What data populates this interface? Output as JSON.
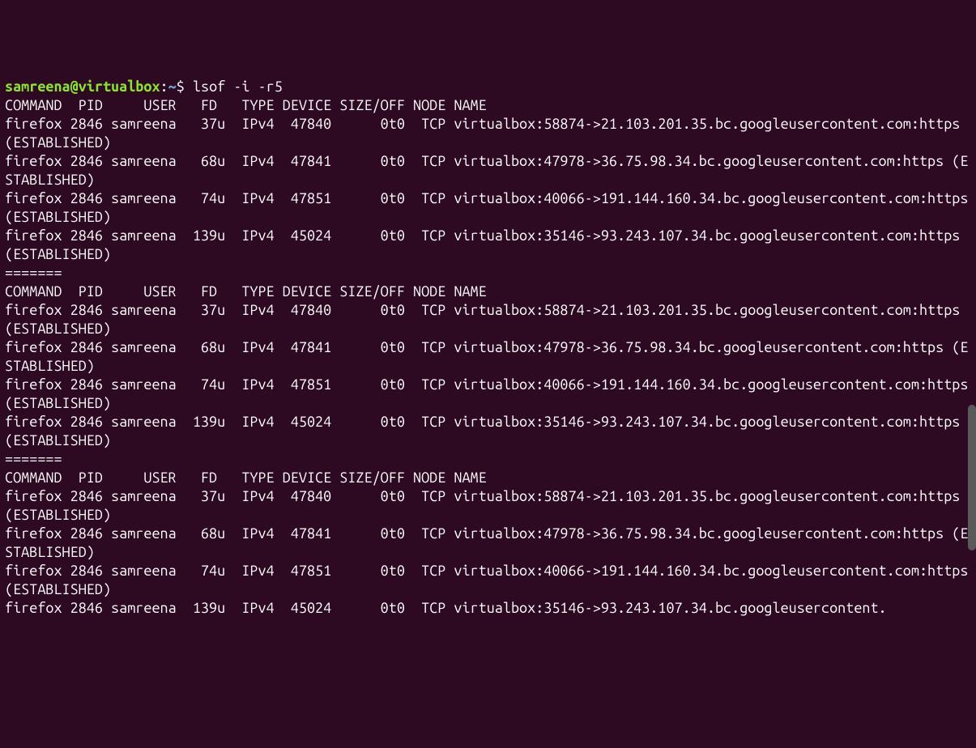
{
  "prompt": {
    "user": "samreena",
    "at": "@",
    "host": "virtualbox",
    "colon": ":",
    "path": "~",
    "dollar": "$ "
  },
  "command": "lsof -i -r5",
  "header": "COMMAND  PID     USER   FD   TYPE DEVICE SIZE/OFF NODE NAME",
  "separator": "=======",
  "blocks": [
    {
      "rows": [
        "firefox 2846 samreena   37u  IPv4  47840      0t0  TCP virtualbox:58874->21.103.201.35.bc.googleusercontent.com:https (ESTABLISHED)",
        "firefox 2846 samreena   68u  IPv4  47841      0t0  TCP virtualbox:47978->36.75.98.34.bc.googleusercontent.com:https (ESTABLISHED)",
        "firefox 2846 samreena   74u  IPv4  47851      0t0  TCP virtualbox:40066->191.144.160.34.bc.googleusercontent.com:https (ESTABLISHED)",
        "firefox 2846 samreena  139u  IPv4  45024      0t0  TCP virtualbox:35146->93.243.107.34.bc.googleusercontent.com:https (ESTABLISHED)"
      ]
    },
    {
      "rows": [
        "firefox 2846 samreena   37u  IPv4  47840      0t0  TCP virtualbox:58874->21.103.201.35.bc.googleusercontent.com:https (ESTABLISHED)",
        "firefox 2846 samreena   68u  IPv4  47841      0t0  TCP virtualbox:47978->36.75.98.34.bc.googleusercontent.com:https (ESTABLISHED)",
        "firefox 2846 samreena   74u  IPv4  47851      0t0  TCP virtualbox:40066->191.144.160.34.bc.googleusercontent.com:https (ESTABLISHED)",
        "firefox 2846 samreena  139u  IPv4  45024      0t0  TCP virtualbox:35146->93.243.107.34.bc.googleusercontent.com:https (ESTABLISHED)"
      ]
    },
    {
      "rows": [
        "firefox 2846 samreena   37u  IPv4  47840      0t0  TCP virtualbox:58874->21.103.201.35.bc.googleusercontent.com:https (ESTABLISHED)",
        "firefox 2846 samreena   68u  IPv4  47841      0t0  TCP virtualbox:47978->36.75.98.34.bc.googleusercontent.com:https (ESTABLISHED)",
        "firefox 2846 samreena   74u  IPv4  47851      0t0  TCP virtualbox:40066->191.144.160.34.bc.googleusercontent.com:https (ESTABLISHED)",
        "firefox 2846 samreena  139u  IPv4  45024      0t0  TCP virtualbox:35146->93.243.107.34.bc.googleusercontent."
      ]
    }
  ]
}
